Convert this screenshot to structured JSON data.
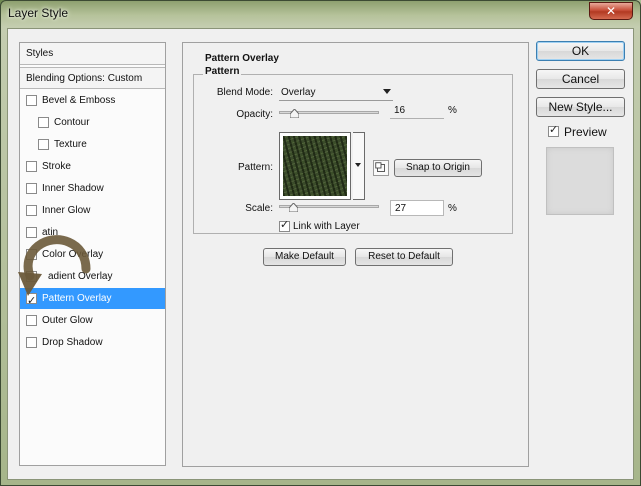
{
  "window": {
    "title": "Layer Style",
    "close_icon": "close-icon"
  },
  "sidebar": {
    "header": "Styles",
    "blending_options": "Blending Options: Custom",
    "items": [
      {
        "label": "Bevel & Emboss",
        "checked": false,
        "indent": false
      },
      {
        "label": "Contour",
        "checked": false,
        "indent": true
      },
      {
        "label": "Texture",
        "checked": false,
        "indent": true
      },
      {
        "label": "Stroke",
        "checked": false,
        "indent": false
      },
      {
        "label": "Inner Shadow",
        "checked": false,
        "indent": false
      },
      {
        "label": "Inner Glow",
        "checked": false,
        "indent": false
      },
      {
        "label": "atin",
        "checked": false,
        "indent": false
      },
      {
        "label": "Color Overlay",
        "checked": false,
        "indent": false
      },
      {
        "label": "adient Overlay",
        "checked": false,
        "indent": false
      },
      {
        "label": "Pattern Overlay",
        "checked": true,
        "indent": false,
        "selected": true
      },
      {
        "label": "Outer Glow",
        "checked": false,
        "indent": false
      },
      {
        "label": "Drop Shadow",
        "checked": false,
        "indent": false
      }
    ]
  },
  "main": {
    "section_title": "Pattern Overlay",
    "group_title": "Pattern",
    "blend_mode": {
      "label": "Blend Mode:",
      "value": "Overlay"
    },
    "opacity": {
      "label": "Opacity:",
      "value": "16",
      "unit": "%",
      "level": 0.16
    },
    "pattern": {
      "label": "Pattern:",
      "snap_button": "Snap to Origin"
    },
    "scale": {
      "label": "Scale:",
      "value": "27",
      "unit": "%",
      "level": 0.27
    },
    "link_with_layer": {
      "label": "Link with Layer",
      "checked": true
    },
    "make_default": "Make Default",
    "reset_to_default": "Reset to Default"
  },
  "actions": {
    "ok": "OK",
    "cancel": "Cancel",
    "new_style": "New Style...",
    "preview": {
      "label": "Preview",
      "checked": true
    }
  }
}
